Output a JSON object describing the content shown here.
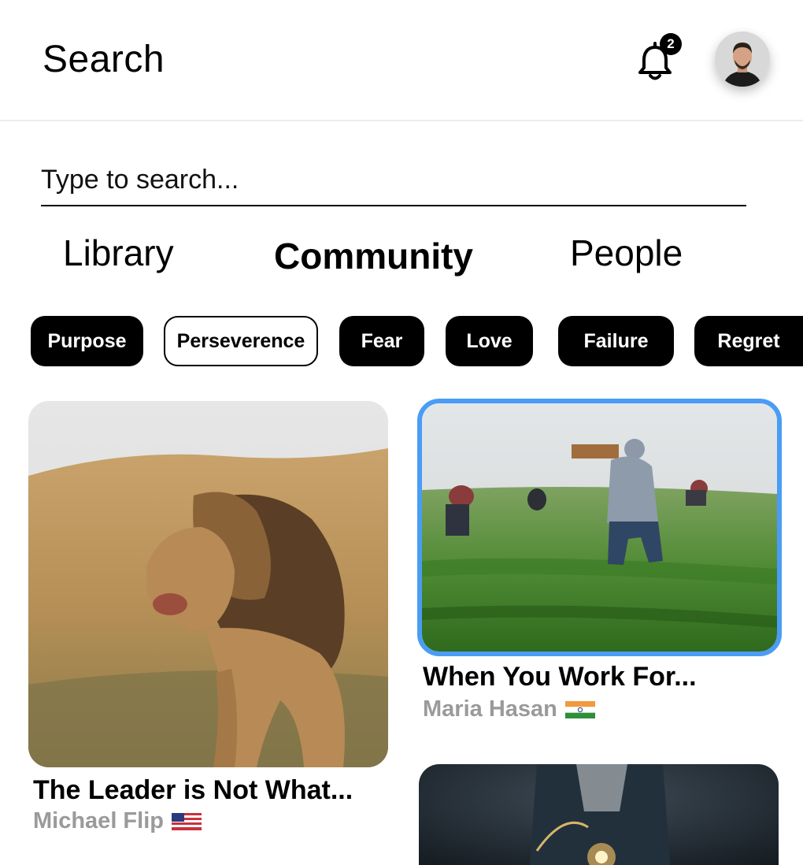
{
  "header": {
    "title": "Search",
    "notification_count": "2",
    "bell_icon": "bell-icon",
    "avatar_icon": "user-avatar"
  },
  "search": {
    "placeholder": "Type to search..."
  },
  "tabs": [
    {
      "label": "Library",
      "active": false
    },
    {
      "label": "Community",
      "active": true
    },
    {
      "label": "People",
      "active": false
    }
  ],
  "chips": [
    {
      "label": "Purpose",
      "selected": false
    },
    {
      "label": "Perseverence",
      "selected": true
    },
    {
      "label": "Fear",
      "selected": false
    },
    {
      "label": "Love",
      "selected": false
    },
    {
      "label": "Failure",
      "selected": false
    },
    {
      "label": "Regret",
      "selected": false
    }
  ],
  "cards": [
    {
      "title": "The Leader is Not What...",
      "author": "Michael Flip",
      "flag": "us-flag-icon",
      "image": "lion-photo"
    },
    {
      "title": "When You Work For...",
      "author": "Maria Hasan",
      "flag": "india-flag-icon",
      "image": "field-workers-photo",
      "highlighted": true
    },
    {
      "title": "",
      "author": "",
      "image": "person-with-lightbulb-photo"
    }
  ],
  "colors": {
    "accent": "#4a9cf5",
    "chip_bg": "#000000",
    "muted_text": "#9a9a9a"
  }
}
